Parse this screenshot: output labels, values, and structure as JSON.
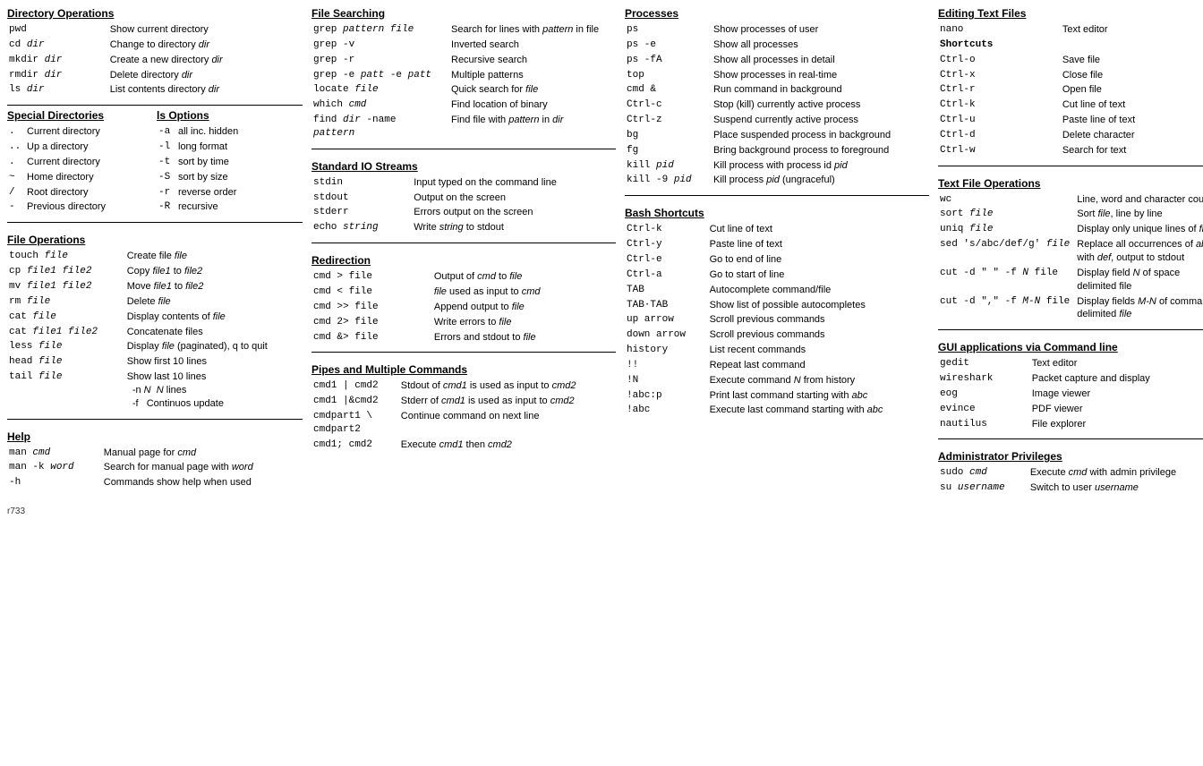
{
  "col1": {
    "dir_ops": {
      "title": "Directory Operations",
      "rows": [
        {
          "cmd": "pwd",
          "desc": "Show current directory"
        },
        {
          "cmd": "cd dir",
          "desc": "Change to directory dir",
          "cmd_italic": "dir"
        },
        {
          "cmd": "mkdir dir",
          "desc": "Create a new directory dir",
          "cmd_italic": "dir"
        },
        {
          "cmd": "rmdir dir",
          "desc": "Delete directory dir",
          "cmd_italic": "dir"
        },
        {
          "cmd": "ls dir",
          "desc": "List contents directory dir",
          "cmd_italic": "dir"
        }
      ]
    },
    "special_dirs": {
      "title": "Special Directories",
      "items": [
        {
          "sym": ".",
          "desc": "Current directory"
        },
        {
          "sym": "..",
          "desc": "Up a directory"
        },
        {
          "sym": ".",
          "desc": "Current directory"
        },
        {
          "sym": "~",
          "desc": "Home directory"
        },
        {
          "sym": "/",
          "desc": "Root directory"
        },
        {
          "sym": "-",
          "desc": "Previous directory"
        }
      ]
    },
    "ls_options": {
      "title": "ls Options",
      "items": [
        {
          "flag": "-a",
          "desc": "all inc. hidden"
        },
        {
          "flag": "-l",
          "desc": "long format"
        },
        {
          "flag": "-t",
          "desc": "sort by time"
        },
        {
          "flag": "-S",
          "desc": "sort by size"
        },
        {
          "flag": "-r",
          "desc": "reverse order"
        },
        {
          "flag": "-R",
          "desc": "recursive"
        }
      ]
    },
    "file_ops": {
      "title": "File Operations",
      "rows": [
        {
          "cmd": "touch file",
          "desc": "Create file file",
          "italics": [
            "file"
          ]
        },
        {
          "cmd": "cp file1 file2",
          "desc": "Copy file1 to file2",
          "italics": [
            "file1",
            "file2"
          ]
        },
        {
          "cmd": "mv file1 file2",
          "desc": "Move file1 to file2",
          "italics": [
            "file1",
            "file2"
          ]
        },
        {
          "cmd": "rm file",
          "desc": "Delete file",
          "italics": [
            "file"
          ]
        },
        {
          "cmd": "cat file",
          "desc": "Display contents of file",
          "italics": [
            "file"
          ]
        },
        {
          "cmd": "cat file1 file2",
          "desc": "Concatenate files"
        },
        {
          "cmd": "less file",
          "desc": "Display file (paginated), q to quit",
          "italics": [
            "file"
          ]
        },
        {
          "cmd": "head file",
          "desc": "Show first 10 lines",
          "italics": [
            "file"
          ]
        },
        {
          "cmd": "tail file",
          "desc": "Show last 10 lines\n-n N  N lines\n-f  Continuos update",
          "italics": [
            "file"
          ]
        }
      ]
    },
    "help": {
      "title": "Help",
      "rows": [
        {
          "cmd": "man cmd",
          "desc": "Manual page for cmd",
          "italics": [
            "cmd"
          ]
        },
        {
          "cmd": "man -k word",
          "desc": "Search for manual page with word",
          "italics": [
            "word"
          ]
        },
        {
          "cmd": "-h",
          "desc": "Commands show help when used"
        }
      ]
    }
  },
  "col2": {
    "file_search": {
      "title": "File Searching",
      "rows": [
        {
          "cmd": "grep pattern file",
          "desc": "Search for lines with pattern in file",
          "italics": [
            "pattern",
            "file"
          ]
        },
        {
          "cmd": "grep -v",
          "desc": "Inverted search"
        },
        {
          "cmd": "grep -r",
          "desc": "Recursive search"
        },
        {
          "cmd": "grep -e patt -e patt",
          "desc": "Multiple patterns",
          "italics": [
            "patt"
          ]
        },
        {
          "cmd": "locate file",
          "desc": "Quick search for file",
          "italics": [
            "file"
          ]
        },
        {
          "cmd": "which cmd",
          "desc": "Find location of binary",
          "italics": [
            "cmd"
          ]
        },
        {
          "cmd": "find dir -name pattern",
          "desc": "Find file with pattern in dir",
          "italics": [
            "dir",
            "pattern"
          ]
        }
      ]
    },
    "std_io": {
      "title": "Standard IO Streams",
      "rows": [
        {
          "cmd": "stdin",
          "desc": "Input typed on the command line"
        },
        {
          "cmd": "stdout",
          "desc": "Output on the screen"
        },
        {
          "cmd": "stderr",
          "desc": "Errors output on the screen"
        },
        {
          "cmd": "echo string",
          "desc": "Write string to stdout",
          "italics": [
            "string"
          ]
        }
      ]
    },
    "redirection": {
      "title": "Redirection",
      "rows": [
        {
          "cmd": "cmd > file",
          "desc": "Output of cmd to file",
          "italics": [
            "cmd",
            "file"
          ]
        },
        {
          "cmd": "cmd < file",
          "desc": "file used as input to cmd",
          "italics": [
            "cmd",
            "file"
          ]
        },
        {
          "cmd": "cmd >> file",
          "desc": "Append output to file",
          "italics": [
            "file"
          ]
        },
        {
          "cmd": "cmd 2> file",
          "desc": "Write errors to file",
          "italics": [
            "file"
          ]
        },
        {
          "cmd": "cmd &> file",
          "desc": "Errors and stdout to file",
          "italics": [
            "file"
          ]
        }
      ]
    },
    "pipes": {
      "title": "Pipes and Multiple Commands",
      "rows": [
        {
          "cmd": "cmd1 | cmd2",
          "desc": "Stdout of cmd1 is used as input to cmd2",
          "italics": [
            "cmd1",
            "cmd2"
          ]
        },
        {
          "cmd": "cmd1 |&cmd2",
          "desc": "Stderr of cmd1 is used as input to cmd2",
          "italics": [
            "cmd1",
            "cmd2"
          ]
        },
        {
          "cmd": "cmdpart1 \\ cmdpart2",
          "desc": "Continue command on next line"
        },
        {
          "cmd": "cmd1; cmd2",
          "desc": "Execute cmd1 then cmd2",
          "italics": [
            "cmd1",
            "cmd2"
          ]
        }
      ]
    }
  },
  "col3": {
    "processes": {
      "title": "Processes",
      "rows": [
        {
          "cmd": "ps",
          "desc": "Show processes of user"
        },
        {
          "cmd": "ps -e",
          "desc": "Show all processes"
        },
        {
          "cmd": "ps -fA",
          "desc": "Show all processes in detail"
        },
        {
          "cmd": "top",
          "desc": "Show processes in real-time"
        },
        {
          "cmd": "cmd &",
          "desc": "Run command in background"
        },
        {
          "cmd": "Ctrl-c",
          "desc": "Stop (kill) currently active process"
        },
        {
          "cmd": "Ctrl-z",
          "desc": "Suspend currently active process"
        },
        {
          "cmd": "bg",
          "desc": "Place suspended process in background"
        },
        {
          "cmd": "fg",
          "desc": "Bring background process to foreground"
        },
        {
          "cmd": "kill pid",
          "desc": "Kill process with process id pid",
          "italics": [
            "pid"
          ]
        },
        {
          "cmd": "kill -9 pid",
          "desc": "Kill process pid (ungraceful)",
          "italics": [
            "pid"
          ]
        }
      ]
    },
    "bash_shortcuts": {
      "title": "Bash Shortcuts",
      "rows": [
        {
          "cmd": "Ctrl-k",
          "desc": "Cut line of text"
        },
        {
          "cmd": "Ctrl-y",
          "desc": "Paste line of text"
        },
        {
          "cmd": "Ctrl-e",
          "desc": "Go to end of line"
        },
        {
          "cmd": "Ctrl-a",
          "desc": "Go to start of line"
        },
        {
          "cmd": "TAB",
          "desc": "Autocomplete command/file"
        },
        {
          "cmd": "TAB·TAB",
          "desc": "Show list of possible autocompletes"
        },
        {
          "cmd": "up arrow",
          "desc": "Scroll previous commands"
        },
        {
          "cmd": "down arrow",
          "desc": "Scroll previous commands"
        },
        {
          "cmd": "history",
          "desc": "List recent commands"
        },
        {
          "cmd": "!!",
          "desc": "Repeat last command"
        },
        {
          "cmd": "!N",
          "desc": "Execute command N from history",
          "italics": [
            "N"
          ]
        },
        {
          "cmd": "!abc:p",
          "desc": "Print last command starting with abc",
          "italics": [
            "abc"
          ]
        },
        {
          "cmd": "!abc",
          "desc": "Execute last command starting with abc",
          "italics": [
            "abc"
          ]
        }
      ]
    }
  },
  "col4": {
    "editing": {
      "title": "Editing Text Files",
      "rows": [
        {
          "cmd": "nano",
          "desc": "Text editor"
        },
        {
          "cmd": "Shortcuts",
          "desc": "",
          "bold": true
        },
        {
          "cmd": "Ctrl-o",
          "desc": "Save file"
        },
        {
          "cmd": "Ctrl-x",
          "desc": "Close file"
        },
        {
          "cmd": "Ctrl-r",
          "desc": "Open file"
        },
        {
          "cmd": "Ctrl-k",
          "desc": "Cut line of text"
        },
        {
          "cmd": "Ctrl-u",
          "desc": "Paste line of text"
        },
        {
          "cmd": "Ctrl-d",
          "desc": "Delete character"
        },
        {
          "cmd": "Ctrl-w",
          "desc": "Search for text"
        }
      ]
    },
    "text_file_ops": {
      "title": "Text File Operations",
      "rows": [
        {
          "cmd": "wc",
          "desc": "Line, word and character count"
        },
        {
          "cmd": "sort file",
          "desc": "Sort file, line by line",
          "italics": [
            "file"
          ]
        },
        {
          "cmd": "uniq file",
          "desc": "Display only unique lines of file",
          "italics": [
            "file"
          ]
        },
        {
          "cmd": "sed 's/abc/def/g' file",
          "desc": "Replace all occurrences of abc with def, output to stdout",
          "italics": [
            "abc",
            "def"
          ]
        },
        {
          "cmd": "cut -d \" \" -f N file",
          "desc": "Display field N of space delimited file",
          "italics": [
            "N"
          ]
        },
        {
          "cmd": "cut -d \",\" -f M-N file",
          "desc": "Display fields M-N of comma delimited file",
          "italics": [
            "M-N",
            "file"
          ]
        }
      ]
    },
    "gui_apps": {
      "title": "GUI applications via Command line",
      "rows": [
        {
          "cmd": "gedit",
          "desc": "Text editor"
        },
        {
          "cmd": "wireshark",
          "desc": "Packet capture and display"
        },
        {
          "cmd": "eog",
          "desc": "Image viewer"
        },
        {
          "cmd": "evince",
          "desc": "PDF viewer"
        },
        {
          "cmd": "nautilus",
          "desc": "File explorer"
        }
      ]
    },
    "admin": {
      "title": "Administrator Privileges",
      "rows": [
        {
          "cmd": "sudo cmd",
          "desc": "Execute cmd with admin privilege",
          "italics": [
            "cmd"
          ]
        },
        {
          "cmd": "su username",
          "desc": "Switch to user username",
          "italics": [
            "username"
          ]
        }
      ]
    }
  },
  "footer": "r733"
}
